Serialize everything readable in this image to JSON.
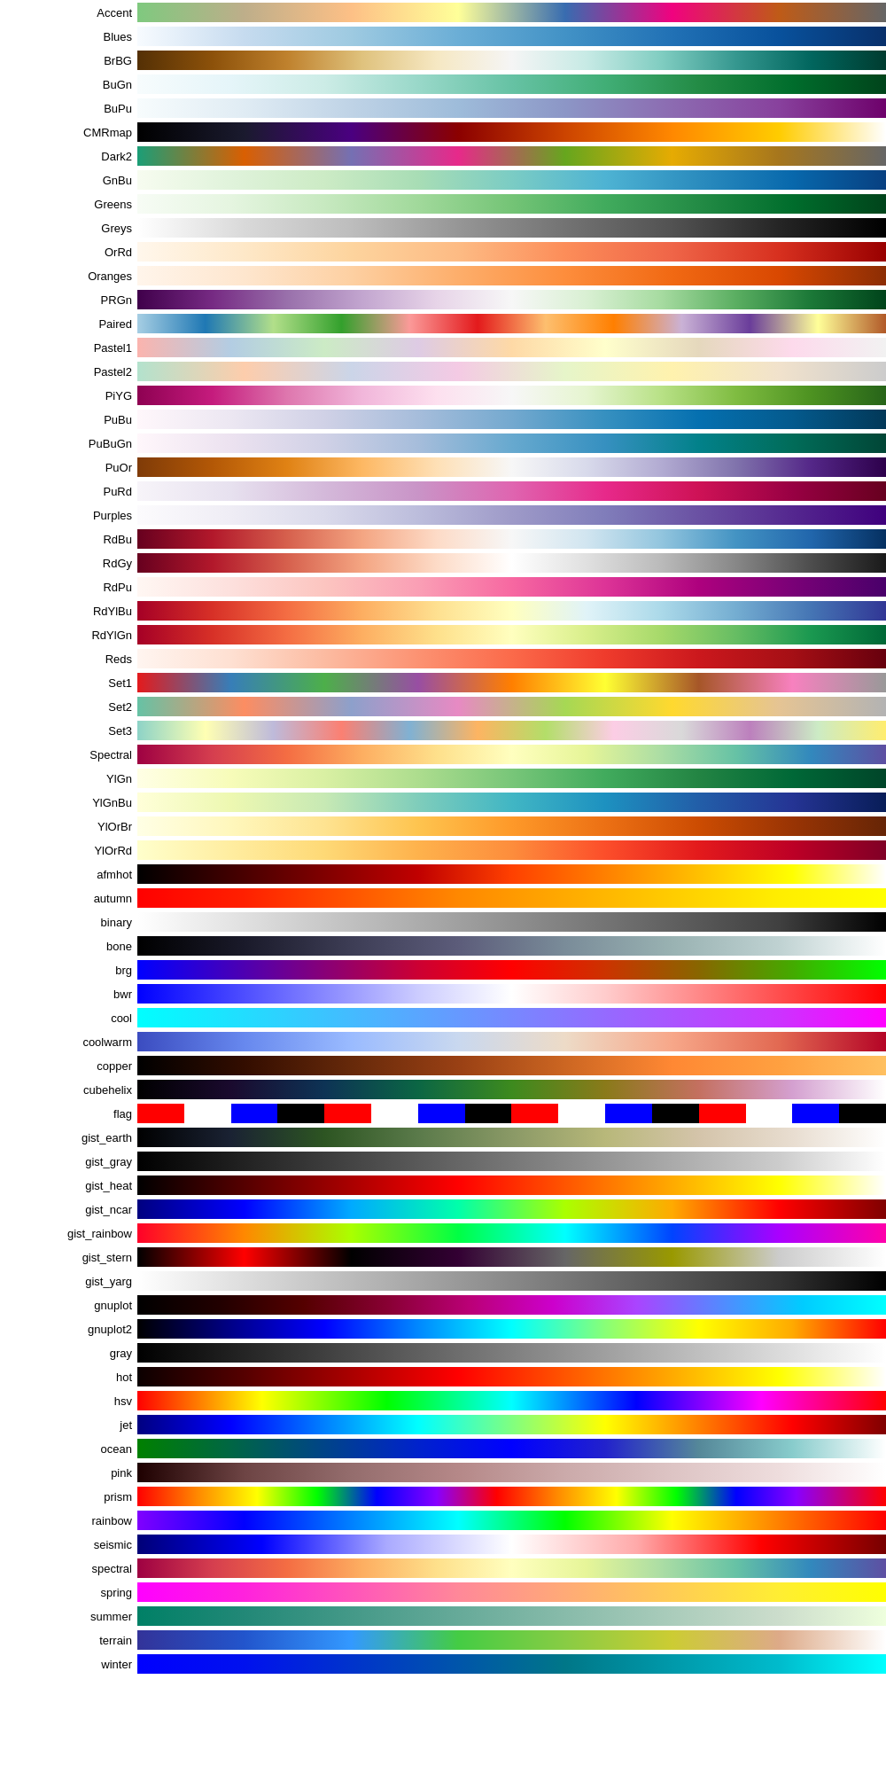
{
  "colormaps": [
    {
      "name": "Accent",
      "gradient": "linear-gradient(to right, #7fc97f, #beae8a, #fdc086, #ffff99, #386cb0, #f0027f, #bf5b17, #666666)"
    },
    {
      "name": "Blues",
      "gradient": "linear-gradient(to right, #f7fbff, #c6dbef, #9ecae1, #6baed6, #4292c6, #2171b5, #08519c, #08306b)"
    },
    {
      "name": "BrBG",
      "gradient": "linear-gradient(to right, #543005, #8c510a, #bf812d, #dfc27d, #f6e8c3, #f5f5f5, #c7eae5, #80cdc1, #35978f, #01665e, #003c30)"
    },
    {
      "name": "BuGn",
      "gradient": "linear-gradient(to right, #f7fcfd, #e5f5f9, #ccece6, #99d8c9, #66c2a4, #41ae76, #238b45, #006d2c, #00441b)"
    },
    {
      "name": "BuPu",
      "gradient": "linear-gradient(to right, #f7fcfd, #e0ecf4, #bfd3e6, #9ebcda, #8c96c6, #8c6bb1, #88419d, #6e016b)"
    },
    {
      "name": "CMRmap",
      "gradient": "linear-gradient(to right, #000000, #1a1a2e, #4a0080, #8b0000, #cc4400, #ff8800, #ffcc00, #ffffff)"
    },
    {
      "name": "Dark2",
      "gradient": "linear-gradient(to right, #1b9e77, #d95f02, #7570b3, #e7298a, #66a61e, #e6ab02, #a6761d, #666666)"
    },
    {
      "name": "GnBu",
      "gradient": "linear-gradient(to right, #f7fcf0, #e0f3db, #ccebc5, #a8ddb5, #7bccc4, #4eb3d3, #2b8cbe, #0868ac, #084081)"
    },
    {
      "name": "Greens",
      "gradient": "linear-gradient(to right, #f7fcf5, #e5f5e0, #c7e9c0, #a1d99b, #74c476, #41ab5d, #238b45, #006d2c, #00441b)"
    },
    {
      "name": "Greys",
      "gradient": "linear-gradient(to right, #ffffff, #d9d9d9, #bdbdbd, #969696, #737373, #525252, #252525, #000000)"
    },
    {
      "name": "OrRd",
      "gradient": "linear-gradient(to right, #fff7ec, #fee8c8, #fdd49e, #fdbb84, #fc8d59, #ef6548, #d7301f, #990000)"
    },
    {
      "name": "Oranges",
      "gradient": "linear-gradient(to right, #fff5eb, #fee6ce, #fdd0a2, #fdae6b, #fd8d3c, #f16913, #d94801, #8c2d04)"
    },
    {
      "name": "PRGn",
      "gradient": "linear-gradient(to right, #40004b, #762a83, #9970ab, #c2a5cf, #e7d4e8, #f7f7f7, #d9f0d3, #a6dba0, #5aae61, #1b7837, #00441b)"
    },
    {
      "name": "Paired",
      "gradient": "linear-gradient(to right, #a6cee3, #1f78b4, #b2df8a, #33a02c, #fb9a99, #e31a1c, #fdbf6f, #ff7f00, #cab2d6, #6a3d9a, #ffff99, #b15928)"
    },
    {
      "name": "Pastel1",
      "gradient": "linear-gradient(to right, #fbb4ae, #b3cde3, #ccebc5, #decbe4, #fed9a6, #ffffcc, #e5d8bd, #fddaec, #f2f2f2)"
    },
    {
      "name": "Pastel2",
      "gradient": "linear-gradient(to right, #b3e2cd, #fdcdac, #cbd5e8, #f4cae4, #e6f5c9, #fff2ae, #f1e2cc, #cccccc)"
    },
    {
      "name": "PiYG",
      "gradient": "linear-gradient(to right, #8e0152, #c51b7d, #de77ae, #f1b6da, #fde0ef, #f7f7f7, #e6f5d0, #b8e186, #7fbc41, #4d9221, #276419)"
    },
    {
      "name": "PuBu",
      "gradient": "linear-gradient(to right, #fff7fb, #ece7f2, #d0d1e6, #a6bddb, #74a9cf, #3690c0, #0570b0, #045a8d, #023858)"
    },
    {
      "name": "PuBuGn",
      "gradient": "linear-gradient(to right, #fff7fb, #ece2f0, #d0d1e6, #a6bddb, #67a9cf, #3690c0, #02818a, #016c59, #014636)"
    },
    {
      "name": "PuOr",
      "gradient": "linear-gradient(to right, #7f3b08, #b35806, #e08214, #fdb863, #fee0b6, #f7f7f7, #d8daeb, #b2abd2, #8073ac, #542788, #2d004b)"
    },
    {
      "name": "PuRd",
      "gradient": "linear-gradient(to right, #f7f4f9, #e7e1ef, #d4b9da, #c994c7, #df65b0, #e7298a, #ce1256, #980043, #67001f)"
    },
    {
      "name": "Purples",
      "gradient": "linear-gradient(to right, #fcfbfd, #efedf5, #dadaeb, #bcbddc, #9e9ac8, #807dba, #6a51a3, #54278f, #3f007d)"
    },
    {
      "name": "RdBu",
      "gradient": "linear-gradient(to right, #67001f, #b2182b, #d6604d, #f4a582, #fddbc7, #f7f7f7, #d1e5f0, #92c5de, #4393c3, #2166ac, #053061)"
    },
    {
      "name": "RdGy",
      "gradient": "linear-gradient(to right, #67001f, #b2182b, #d6604d, #f4a582, #fddbc7, #ffffff, #e0e0e0, #bababa, #878787, #4d4d4d, #1a1a1a)"
    },
    {
      "name": "RdPu",
      "gradient": "linear-gradient(to right, #fff7f3, #fde0dd, #fcc5c0, #fa9fb5, #f768a1, #dd3497, #ae017e, #7a0177, #49006a)"
    },
    {
      "name": "RdYlBu",
      "gradient": "linear-gradient(to right, #a50026, #d73027, #f46d43, #fdae61, #fee090, #ffffbf, #e0f3f8, #abd9e9, #74add1, #4575b4, #313695)"
    },
    {
      "name": "RdYlGn",
      "gradient": "linear-gradient(to right, #a50026, #d73027, #f46d43, #fdae61, #fee08b, #ffffbf, #d9ef8b, #a6d96a, #66bd63, #1a9850, #006837)"
    },
    {
      "name": "Reds",
      "gradient": "linear-gradient(to right, #fff5f0, #fee0d2, #fcbba1, #fc9272, #fb6a4a, #ef3b2c, #cb181d, #a50f15, #67000d)"
    },
    {
      "name": "Set1",
      "gradient": "linear-gradient(to right, #e41a1c, #377eb8, #4daf4a, #984ea3, #ff7f00, #ffff33, #a65628, #f781bf, #999999)"
    },
    {
      "name": "Set2",
      "gradient": "linear-gradient(to right, #66c2a5, #fc8d62, #8da0cb, #e78ac3, #a6d854, #ffd92f, #e5c494, #b3b3b3)"
    },
    {
      "name": "Set3",
      "gradient": "linear-gradient(to right, #8dd3c7, #ffffb3, #bebada, #fb8072, #80b1d3, #fdb462, #b3de69, #fccde5, #d9d9d9, #bc80bd, #ccebc5, #ffed6f)"
    },
    {
      "name": "Spectral",
      "gradient": "linear-gradient(to right, #9e0142, #d53e4f, #f46d43, #fdae61, #fee08b, #ffffbf, #e6f598, #abdda4, #66c2a5, #3288bd, #5e4fa2)"
    },
    {
      "name": "YlGn",
      "gradient": "linear-gradient(to right, #ffffe5, #f7fcb9, #d9f0a3, #addd8e, #78c679, #41ab5d, #238443, #006837, #004529)"
    },
    {
      "name": "YlGnBu",
      "gradient": "linear-gradient(to right, #ffffd9, #edf8b1, #c7e9b4, #7fcdbb, #41b6c4, #1d91c0, #225ea8, #253494, #081d58)"
    },
    {
      "name": "YlOrBr",
      "gradient": "linear-gradient(to right, #ffffe5, #fff7bc, #fee391, #fec44f, #fe9929, #ec7014, #cc4c02, #993404, #662506)"
    },
    {
      "name": "YlOrRd",
      "gradient": "linear-gradient(to right, #ffffcc, #ffeda0, #fed976, #feb24c, #fd8d3c, #fc4e2a, #e31a1c, #bd0026, #800026)"
    },
    {
      "name": "afmhot",
      "gradient": "linear-gradient(to right, #000000, #400000, #800000, #c00000, #ff4000, #ff8000, #ffc000, #ffff00, #ffffff)"
    },
    {
      "name": "autumn",
      "gradient": "linear-gradient(to right, #ff0000, #ff2000, #ff5500, #ff8800, #ffaa00, #ffcc00, #ffee00, #ffff00)"
    },
    {
      "name": "binary",
      "gradient": "linear-gradient(to right, #ffffff, #e0e0e0, #c0c0c0, #a0a0a0, #808080, #606060, #404040, #000000)"
    },
    {
      "name": "bone",
      "gradient": "linear-gradient(to right, #000000, #1a1a2a, #3d3d55, #5c5c7a, #7a8c99, #99b2b2, #bfd2d2, #ffffff)"
    },
    {
      "name": "brg",
      "gradient": "linear-gradient(to right, #0000ff, #4400bb, #880077, #cc0033, #ff0000, #cc3300, #886600, #44aa00, #00ff00)"
    },
    {
      "name": "bwr",
      "gradient": "linear-gradient(to right, #0000ff, #4444ff, #8888ff, #ccccff, #ffffff, #ffcccc, #ff8888, #ff4444, #ff0000)"
    },
    {
      "name": "cool",
      "gradient": "linear-gradient(to right, #00ffff, #22ddff, #44bbff, #6699ff, #8877ff, #aa55ff, #cc33ff, #ff00ff)"
    },
    {
      "name": "coolwarm",
      "gradient": "linear-gradient(to right, #3b4cc0, #6788ee, #9abbff, #c9d8ef, #eddbc7, #f7a789, #e26952, #b40426)"
    },
    {
      "name": "copper",
      "gradient": "linear-gradient(to right, #000000, #330d00, #66290a, #994014, #cc6622, #ff8833, #ffa040, #ffc060)"
    },
    {
      "name": "cubehelix",
      "gradient": "linear-gradient(to right, #000000, #1a0a2e, #0d3355, #0b6644, #3d8a1e, #8a7a1a, #c47060, #d4a0d0, #ffffff)"
    },
    {
      "name": "flag",
      "gradient": "repeating-linear-gradient(to right, #ff0000 0%, #ff0000 6.25%, #ffffff 6.25%, #ffffff 12.5%, #0000ff 12.5%, #0000ff 18.75%, #000000 18.75%, #000000 25%)"
    },
    {
      "name": "gist_earth",
      "gradient": "linear-gradient(to right, #000000, #1a2233, #2d5522, #5a7a4a, #8a9966, #b8b87a, #d4c4aa, #e8ddd0, #ffffff)"
    },
    {
      "name": "gist_gray",
      "gradient": "linear-gradient(to right, #000000, #222222, #444444, #666666, #888888, #aaaaaa, #cccccc, #ffffff)"
    },
    {
      "name": "gist_heat",
      "gradient": "linear-gradient(to right, #000000, #550000, #aa0000, #ff0000, #ff5500, #ffaa00, #ffff00, #ffffff)"
    },
    {
      "name": "gist_ncar",
      "gradient": "linear-gradient(to right, #000080, #0000ff, #00aaff, #00ffaa, #aaff00, #ffaa00, #ff0000, #800000)"
    },
    {
      "name": "gist_rainbow",
      "gradient": "linear-gradient(to right, #ff0029, #ff8800, #aaff00, #00ff44, #00ffff, #0044ff, #aa00ff, #ff00aa)"
    },
    {
      "name": "gist_stern",
      "gradient": "linear-gradient(to right, #000000, #ff0000, #000000, #330033, #666666, #999900, #cccccc, #ffffff)"
    },
    {
      "name": "gist_yarg",
      "gradient": "linear-gradient(to right, #ffffff, #dddddd, #bbbbbb, #999999, #777777, #555555, #333333, #000000)"
    },
    {
      "name": "gnuplot",
      "gradient": "linear-gradient(to right, #000000, #220000, #550000, #880033, #bb0077, #cc00cc, #aa44ff, #5588ff, #00ccff, #00ffff)"
    },
    {
      "name": "gnuplot2",
      "gradient": "linear-gradient(to right, #000000, #000088, #0000ff, #0088ff, #00ffff, #88ff77, #ffff00, #ffaa00, #ff0000)"
    },
    {
      "name": "gray",
      "gradient": "linear-gradient(to right, #000000, #333333, #666666, #999999, #cccccc, #ffffff)"
    },
    {
      "name": "hot",
      "gradient": "linear-gradient(to right, #0b0000, #550000, #aa0000, #ff0000, #ff5500, #ffaa00, #ffff00, #ffffff)"
    },
    {
      "name": "hsv",
      "gradient": "linear-gradient(to right, #ff0000, #ffff00, #00ff00, #00ffff, #0000ff, #ff00ff, #ff0000)"
    },
    {
      "name": "jet",
      "gradient": "linear-gradient(to right, #000080, #0000ff, #0080ff, #00ffff, #80ff80, #ffff00, #ff8000, #ff0000, #800000)"
    },
    {
      "name": "ocean",
      "gradient": "linear-gradient(to right, #008000, #006644, #004488, #0022cc, #0000ff, #2222cc, #558899, #88cccc, #ffffff)"
    },
    {
      "name": "pink",
      "gradient": "linear-gradient(to right, #1e0000, #6d4444, #946d6d, #b58888, #cbaaaa, #ddc4c4, #eedddd, #ffffff)"
    },
    {
      "name": "prism",
      "gradient": "repeating-linear-gradient(to right, #ff0000 0%, #ff8800 8%, #ffff00 16%, #00ff00 24%, #0000ff 32%, #8800ff 40%, #ff0000 48%, #ff8800 56%, #ffff00 64%, #00ff00 72%, #0000ff 80%, #8800ff 88%, #ff0000 100%)"
    },
    {
      "name": "rainbow",
      "gradient": "linear-gradient(to right, #8000ff, #0000ff, #0080ff, #00ffff, #00ff00, #ffff00, #ff8000, #ff0000)"
    },
    {
      "name": "seismic",
      "gradient": "linear-gradient(to right, #000077, #0000ff, #aaaaff, #ffffff, #ffaaaa, #ff0000, #770000)"
    },
    {
      "name": "spectral",
      "gradient": "linear-gradient(to right, #9e0142, #d53e4f, #f46d43, #fdae61, #fee08b, #ffffbf, #e6f598, #abdda4, #66c2a5, #3288bd, #5e4fa2)"
    },
    {
      "name": "spring",
      "gradient": "linear-gradient(to right, #ff00ff, #ff22dd, #ff55bb, #ff8899, #ffaa77, #ffcc55, #ffee33, #ffff00)"
    },
    {
      "name": "summer",
      "gradient": "linear-gradient(to right, #008066, #228877, #449988, #66aa99, #88bbaa, #aaccbb, #ccddcc, #eeffdd)"
    },
    {
      "name": "terrain",
      "gradient": "linear-gradient(to right, #333399, #2255cc, #3399ff, #44cc44, #88cc44, #cccc33, #ddaa88, #ffffff)"
    },
    {
      "name": "winter",
      "gradient": "linear-gradient(to right, #0000ff, #0011ee, #0033cc, #0055aa, #007788, #0099aa, #00bbcc, #00ffff)"
    }
  ]
}
